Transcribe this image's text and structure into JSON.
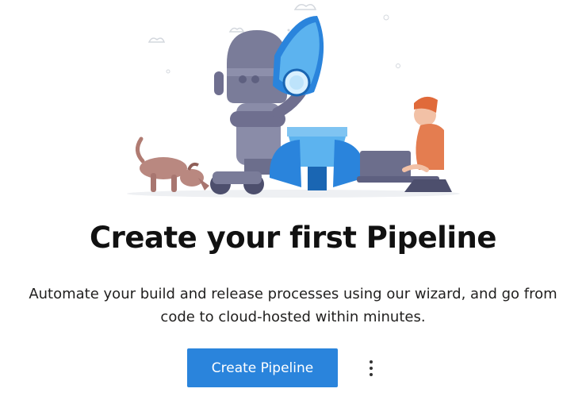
{
  "empty_state": {
    "title": "Create your first Pipeline",
    "description_line1": "Automate your build and release processes using our wizard, and go from",
    "description_line2": "code to cloud-hosted within minutes.",
    "primary_button_label": "Create Pipeline",
    "more_actions_icon": "more-vertical-icon"
  },
  "colors": {
    "accent": "#2a84dc",
    "title": "#111111",
    "text": "#201f1e"
  },
  "illustration": {
    "icon": "pipeline-illustration"
  }
}
